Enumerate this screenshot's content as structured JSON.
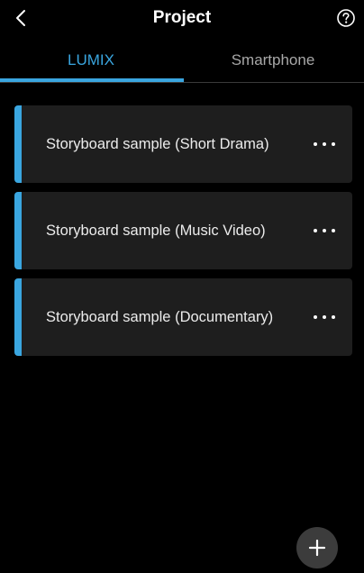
{
  "header": {
    "title": "Project",
    "back_icon": "chevron-left-icon",
    "help_icon": "question-circle-icon"
  },
  "tabs": [
    {
      "label": "LUMIX",
      "active": true
    },
    {
      "label": "Smartphone",
      "active": false
    }
  ],
  "colors": {
    "accent": "#3aa6e0",
    "background": "#000000",
    "card": "#1e1e1e",
    "inactive_tab": "#a8a8a8"
  },
  "projects": [
    {
      "title": "Storyboard sample (Short Drama)",
      "menu_icon": "more-horizontal-icon"
    },
    {
      "title": "Storyboard sample (Music Video)",
      "menu_icon": "more-horizontal-icon"
    },
    {
      "title": "Storyboard sample (Documentary)",
      "menu_icon": "more-horizontal-icon"
    }
  ],
  "fab": {
    "icon": "plus-icon"
  }
}
